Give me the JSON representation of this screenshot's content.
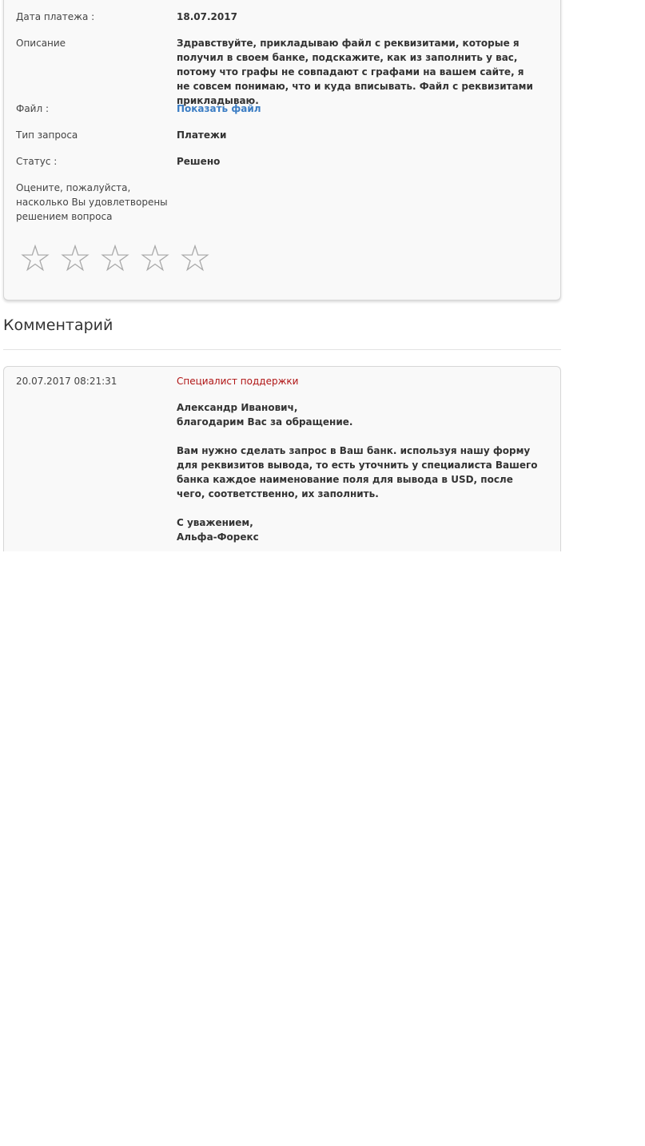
{
  "request": {
    "payment_date": {
      "label": "Дата платежа :",
      "value": "18.07.2017"
    },
    "description": {
      "label": "Описание",
      "value": "Здравствуйте, прикладываю файл с реквизитами, которые я получил в своем банке, подскажите, как из заполнить у вас, потому что графы не совпадают с графами на вашем сайте, я не совсем понимаю, что и куда вписывать. Файл с реквизитами прикладываю."
    },
    "file": {
      "label": "Файл :",
      "link": "Показать файл"
    },
    "request_type": {
      "label": "Тип запроса",
      "value": "Платежи"
    },
    "status": {
      "label": "Статус :",
      "value": "Решено"
    },
    "rating": {
      "prompt": "Оцените, пожалуйста, насколько Вы удовлетворены решением вопроса",
      "max": 5,
      "value": 0,
      "star_glyph": "☆",
      "star_color": "#a8a8a8"
    }
  },
  "comments_section": {
    "title": "Комментарий",
    "comments": [
      {
        "date": "20.07.2017 08:21:31",
        "author": "Специалист поддержки",
        "author_color": "#b01515",
        "body": {
          "greeting_name": "Александр Иванович,",
          "greeting_thanks": "благодарим Вас за обращение.",
          "paragraph": "Вам нужно сделать запрос в Ваш банк. используя нашу форму для реквизитов вывода, то есть уточнить у специалиста Вашего банка каждое наименование поля для вывода в USD, после чего, соответственно, их заполнить.",
          "sign_off": "С уважением,",
          "signature": "Альфа-Форекс"
        }
      }
    ]
  },
  "colors": {
    "card_background": "#f9f9f9",
    "link": "#3b7dc4",
    "text": "#333333"
  }
}
